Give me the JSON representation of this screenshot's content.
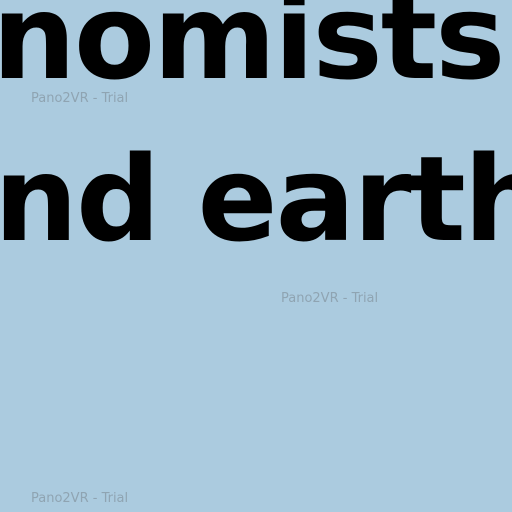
{
  "panorama": {
    "background_color": "#abcbdf",
    "text_color": "#000000",
    "lines": [
      "nomists",
      "nd earth"
    ]
  },
  "watermarks": [
    "Pano2VR - Trial",
    "Pano2VR - Trial",
    "Pano2VR - Trial"
  ]
}
